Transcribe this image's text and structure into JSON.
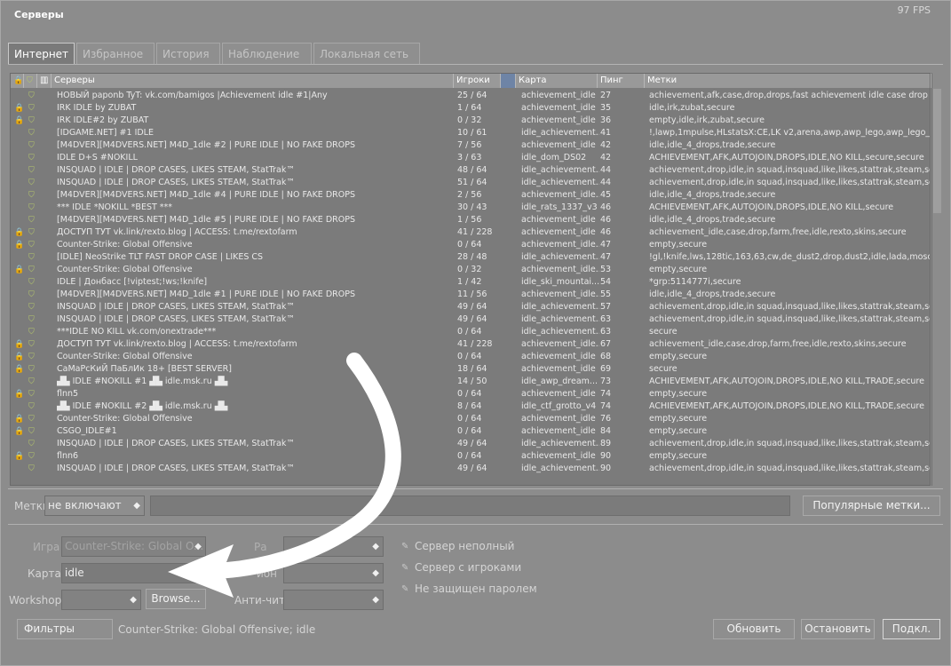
{
  "window": {
    "title": "Серверы",
    "fps": "97 FPS"
  },
  "tabs": [
    "Интернет",
    "Избранное",
    "История",
    "Наблюдение",
    "Локальная сеть"
  ],
  "columns": {
    "servers": "Серверы",
    "players": "Игроки",
    "map": "Карта",
    "ping": "Пинг",
    "tags": "Метки"
  },
  "rows": [
    {
      "lock": false,
      "name": "  НОВЫЙ paponb TyT: vk.com/bamigos |Achievement idle #1|Any",
      "players": "25 / 64",
      "map": "achievement_idle",
      "ping": "27",
      "tags": "achievement,afk,case,drop,drops,fast achievement idle case drop kni..."
    },
    {
      "lock": true,
      "name": "IRK IDLE by ZUBAT",
      "players": "1 / 64",
      "map": "achievement_idle",
      "ping": "35",
      "tags": "idle,irk,zubat,secure"
    },
    {
      "lock": true,
      "name": "IRK IDLE#2 by ZUBAT",
      "players": "0 / 32",
      "map": "achievement_idle",
      "ping": "36",
      "tags": "empty,idle,irk,zubat,secure"
    },
    {
      "lock": false,
      "name": "[IDGAME.NET] #1 IDLE",
      "players": "10 / 61",
      "map": "idle_achievement...",
      "ping": "41",
      "tags": "!,lawp,1mpulse,HLstatsX:CE,LK v2,arena,awp,awp_lego,awp_lego_2,..."
    },
    {
      "lock": false,
      "name": "[M4DVER][M4DVERS.NET] M4D_1dle #2 | PURE IDLE | NO FAKE DROPS",
      "players": "7 / 56",
      "map": "achievement_idle",
      "ping": "42",
      "tags": "idle,idle_4_drops,trade,secure"
    },
    {
      "lock": false,
      "name": "IDLE D+S #NOKILL",
      "players": "3 / 63",
      "map": "idle_dom_DS02",
      "ping": "42",
      "tags": "ACHIEVEMENT,AFK,AUTOJOIN,DROPS,IDLE,NO KILL,secure,secure"
    },
    {
      "lock": false,
      "name": "INSQUAD | IDLE | DROP CASES, LIKES STEAM, StatTrak™",
      "players": "48 / 64",
      "map": "idle_achievement...",
      "ping": "44",
      "tags": "achievement,drop,idle,in squad,insquad,like,likes,stattrak,steam,secure"
    },
    {
      "lock": false,
      "name": "INSQUAD | IDLE | DROP CASES, LIKES STEAM, StatTrak™",
      "players": "51 / 64",
      "map": "idle_achievement...",
      "ping": "44",
      "tags": "achievement,drop,idle,in squad,insquad,like,likes,stattrak,steam,secure"
    },
    {
      "lock": false,
      "name": "[M4DVER][M4DVERS.NET] M4D_1dle #4 | PURE IDLE | NO FAKE DROPS",
      "players": "2 / 56",
      "map": "achievement_idle...",
      "ping": "45",
      "tags": "idle,idle_4_drops,trade,secure"
    },
    {
      "lock": false,
      "name": "              *** IDLE *NOKILL *BEST ***",
      "players": "30 / 43",
      "map": "idle_rats_1337_v3",
      "ping": "46",
      "tags": "ACHIEVEMENT,AFK,AUTOJOIN,DROPS,IDLE,NO KILL,secure"
    },
    {
      "lock": false,
      "name": "[M4DVER][M4DVERS.NET] M4D_1dle #5 | PURE IDLE | NO FAKE DROPS",
      "players": "1 / 56",
      "map": "achievement_idle",
      "ping": "46",
      "tags": "idle,idle_4_drops,trade,secure"
    },
    {
      "lock": true,
      "name": "ДОСТУП ТУТ vk.link/rexto.blog | ACCESS: t.me/rextofarm",
      "players": "41 / 228",
      "map": "achievement_idle",
      "ping": "46",
      "tags": "achievement_idle,case,drop,farm,free,idle,rexto,skins,secure"
    },
    {
      "lock": true,
      "name": "Counter-Strike: Global Offensive",
      "players": "0 / 64",
      "map": "achievement_idle...",
      "ping": "47",
      "tags": "empty,secure"
    },
    {
      "lock": false,
      "name": "[IDLE] NeoStrike TLT FAST DROP CASE | LIKES CS",
      "players": "28 / 48",
      "map": "idle_achievement...",
      "ping": "47",
      "tags": "!gl,!knife,lws,128tic,163,63,cw,de_dust2,drop,dust2,idle,lada,moscow,..."
    },
    {
      "lock": true,
      "name": "Counter-Strike: Global Offensive",
      "players": "0 / 32",
      "map": "achievement_idle...",
      "ping": "53",
      "tags": "empty,secure"
    },
    {
      "lock": false,
      "name": "IDLE | Донбасс [!viptest;!ws;!knife]",
      "players": "1 / 42",
      "map": "idle_ski_mountai...",
      "ping": "54",
      "tags": "*grp:5114777i,secure"
    },
    {
      "lock": false,
      "name": "[M4DVER][M4DVERS.NET] M4D_1dle #1 | PURE IDLE | NO FAKE DROPS",
      "players": "11 / 56",
      "map": "achievement_idle...",
      "ping": "55",
      "tags": "idle,idle_4_drops,trade,secure"
    },
    {
      "lock": false,
      "name": "INSQUAD | IDLE | DROP CASES, LIKES STEAM, StatTrak™",
      "players": "49 / 64",
      "map": "idle_achievement...",
      "ping": "57",
      "tags": "achievement,drop,idle,in squad,insquad,like,likes,stattrak,steam,secure"
    },
    {
      "lock": false,
      "name": "INSQUAD | IDLE | DROP CASES, LIKES STEAM, StatTrak™",
      "players": "49 / 64",
      "map": "idle_achievement...",
      "ping": "63",
      "tags": "achievement,drop,idle,in squad,insquad,like,likes,stattrak,steam,secure"
    },
    {
      "lock": false,
      "name": "***IDLE NO KILL vk.com/onextrade***",
      "players": "0 / 64",
      "map": "idle_achievement...",
      "ping": "63",
      "tags": "secure"
    },
    {
      "lock": true,
      "name": "ДОСТУП ТУТ vk.link/rexto.blog | ACCESS: t.me/rextofarm",
      "players": "41 / 228",
      "map": "achievement_idle...",
      "ping": "67",
      "tags": "achievement_idle,case,drop,farm,free,idle,rexto,skins,secure"
    },
    {
      "lock": true,
      "name": "Counter-Strike: Global Offensive",
      "players": "0 / 64",
      "map": "achievement_idle",
      "ping": "68",
      "tags": "empty,secure"
    },
    {
      "lock": true,
      "name": "СаМаРсКиЙ ПаБлИк 18+ [BEST SERVER]",
      "players": "18 / 64",
      "map": "achievement_idle",
      "ping": "69",
      "tags": "secure"
    },
    {
      "lock": false,
      "name": "▟▙ IDLE #NOKILL #1 ▟▙ idle.msk.ru ▟▙",
      "players": "14 / 50",
      "map": "idle_awp_dream...",
      "ping": "73",
      "tags": "ACHIEVEMENT,AFK,AUTOJOIN,DROPS,IDLE,NO KILL,TRADE,secure"
    },
    {
      "lock": true,
      "name": "flnn5",
      "players": "0 / 64",
      "map": "achievement_idle",
      "ping": "74",
      "tags": "empty,secure"
    },
    {
      "lock": false,
      "name": "▟▙ IDLE #NOKILL #2 ▟▙ idle.msk.ru ▟▙",
      "players": "8 / 64",
      "map": "idle_ctf_grotto_v4",
      "ping": "74",
      "tags": "ACHIEVEMENT,AFK,AUTOJOIN,DROPS,IDLE,NO KILL,TRADE,secure"
    },
    {
      "lock": true,
      "name": "Counter-Strike: Global Offensive",
      "players": "0 / 64",
      "map": "achievement_idle",
      "ping": "76",
      "tags": "empty,secure"
    },
    {
      "lock": true,
      "name": "CSGO_IDLE#1",
      "players": "0 / 64",
      "map": "achievement_idle",
      "ping": "84",
      "tags": "empty,secure"
    },
    {
      "lock": false,
      "name": "INSQUAD | IDLE | DROP CASES, LIKES STEAM, StatTrak™",
      "players": "49 / 64",
      "map": "idle_achievement...",
      "ping": "89",
      "tags": "achievement,drop,idle,in squad,insquad,like,likes,stattrak,steam,secure"
    },
    {
      "lock": true,
      "name": "flnn6",
      "players": "0 / 64",
      "map": "achievement_idle",
      "ping": "90",
      "tags": "empty,secure"
    },
    {
      "lock": false,
      "name": "INSQUAD | IDLE | DROP CASES, LIKES STEAM, StatTrak™",
      "players": "49 / 64",
      "map": "idle_achievement...",
      "ping": "90",
      "tags": "achievement,drop,idle,in squad,insquad,like,likes,stattrak,steam,secure"
    }
  ],
  "tagfilter": {
    "label": "Метки",
    "mode": "не включают",
    "value": "",
    "popular_button": "Популярные метки..."
  },
  "filters": {
    "game_label": "Игра",
    "game_value": "Counter-Strike: Global O...",
    "location_label": "Ра",
    "map_label": "Карта",
    "map_value": "idle",
    "region_label": "ион",
    "workshop_label": "Workshop",
    "browse_button": "Browse...",
    "anticheat_label": "Анти-чит",
    "checkbox_not_full": "Сервер неполный",
    "checkbox_has_players": "Сервер с игроками",
    "checkbox_no_password": "Не защищен паролем"
  },
  "footer": {
    "filters_button": "Фильтры",
    "filter_summary": "Counter-Strike: Global Offensive; idle",
    "refresh_button": "Обновить",
    "stop_button": "Остановить",
    "connect_button": "Подкл."
  },
  "colors": {
    "lock": "#d4a628",
    "shield": "#b6c86b",
    "background": "#8c8c8c",
    "list_bg": "#7b7b7b",
    "arrow": "#ffffff"
  }
}
